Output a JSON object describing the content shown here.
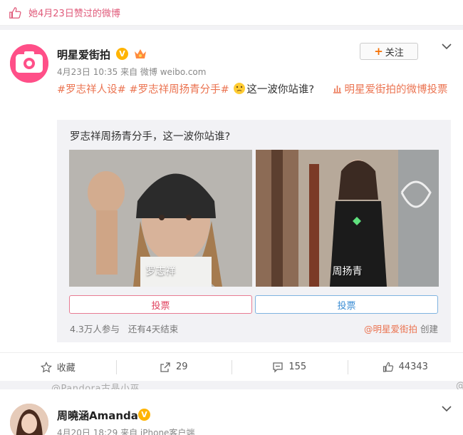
{
  "liked_bar": {
    "text": "她4月23日赞过的微博"
  },
  "post": {
    "author": "明星爱街拍",
    "avatar_text": "明星爱街拍",
    "meta": "4月23日 10:35 来自 微博 weibo.com",
    "follow_label": "关注",
    "tag1": "#罗志祥人设#",
    "tag2": "#罗志祥周扬青分手#",
    "body": "这一波你站谁?",
    "poll_link": "明星爱街拍的微博投票"
  },
  "poll": {
    "question": "罗志祥周扬青分手，这一波你站谁?",
    "options": [
      {
        "name": "罗志祥",
        "vote_label": "投票"
      },
      {
        "name": "周扬青",
        "vote_label": "投票"
      }
    ],
    "participants": "4.3万人参与",
    "remaining": "还有4天结束",
    "creator": "@明星爱街拍",
    "created": "创建"
  },
  "actions": {
    "favorite": "收藏",
    "repost": "29",
    "comment": "155",
    "like": "44343"
  },
  "ghost_text": "@Pandora古晶小巫",
  "next_post": {
    "author": "周曉涵Amanda",
    "meta": "4月20日 18:29 来自 iPhone客户端"
  },
  "colors": {
    "accent": "#eb7350",
    "pink": "#ff4f88",
    "verify": "#ffb400"
  }
}
